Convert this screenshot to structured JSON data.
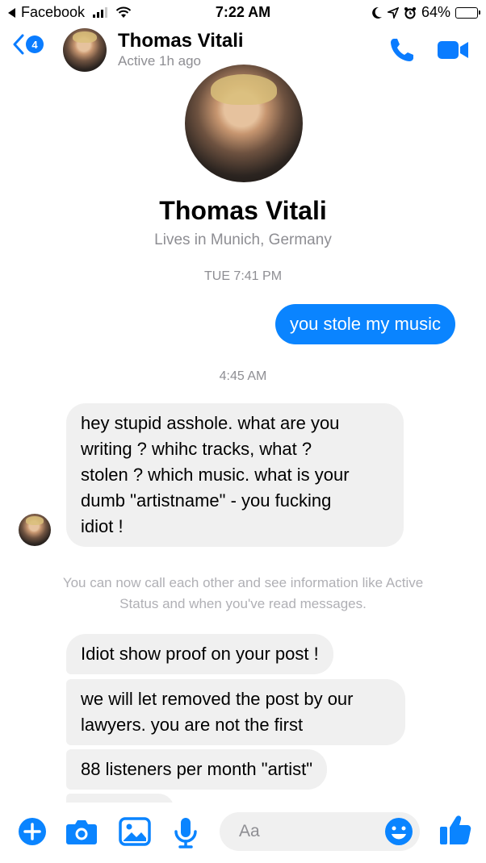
{
  "status_bar": {
    "back_app": "Facebook",
    "time": "7:22 AM",
    "battery": "64%"
  },
  "header": {
    "back_badge": "4",
    "contact_name": "Thomas Vitali",
    "active_status": "Active 1h ago"
  },
  "profile": {
    "name": "Thomas Vitali",
    "location": "Lives in Munich, Germany"
  },
  "timestamps": {
    "first": "TUE 7:41 PM",
    "second": "4:45 AM"
  },
  "messages": {
    "outgoing_1": "you stole my music",
    "incoming_1_lines": [
      "hey stupid asshole. what are you",
      "writing ? whihc tracks, what ?",
      "stolen ? which music. what is your",
      "dumb \"artistname\" - you fucking",
      "idiot !"
    ],
    "info_lines": [
      "You can now call each other and see information like Active",
      "Status and when you've read messages."
    ],
    "incoming_2": "Idiot show proof on your post !",
    "incoming_3_lines": [
      "we will let removed the post by our",
      "lawyers. you are not the first"
    ],
    "incoming_4": "88 listeners per month \"artist\""
  },
  "composer": {
    "placeholder": "Aa",
    "icons": [
      "plus-icon",
      "camera-icon",
      "image-icon",
      "microphone-icon",
      "emoji-icon",
      "thumbs-up-icon"
    ]
  },
  "colors": {
    "accent": "#0a84ff",
    "bubble_in": "#f0f0f0",
    "muted_text": "#8e8e93"
  }
}
